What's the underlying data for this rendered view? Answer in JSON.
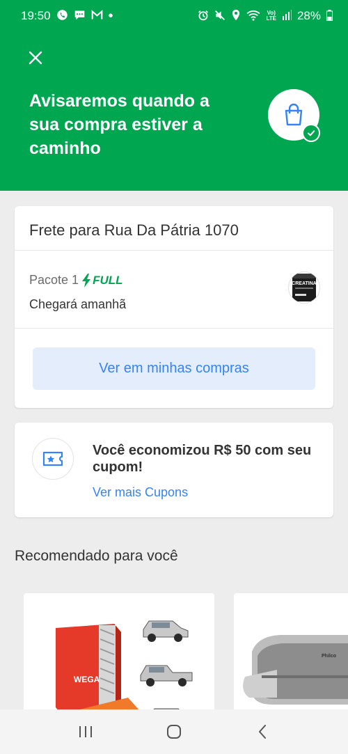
{
  "status_bar": {
    "time": "19:50",
    "battery": "28%",
    "left_icons": [
      "whatsapp-icon",
      "chat-icon",
      "gmail-icon"
    ],
    "right_icons": [
      "alarm-icon",
      "mute-icon",
      "location-icon",
      "wifi-icon",
      "volte-icon",
      "signal-icon",
      "battery-icon"
    ]
  },
  "header": {
    "headline": "Avisaremos quando a sua compra estiver a caminho",
    "background_color": "#00a650"
  },
  "shipping": {
    "title": "Frete para Rua Da Pátria 1070",
    "package_label": "Pacote 1",
    "full_label": "FULL",
    "arrival": "Chegará amanhã",
    "product_thumb_text": "CREATINA",
    "button_label": "Ver em minhas compras"
  },
  "coupon": {
    "text": "Você economizou R$ 50 com seu cupom!",
    "link_label": "Ver mais Cupons"
  },
  "recommendations": {
    "title": "Recomendado para você",
    "product_1_brand": "WEGA",
    "product_2_brand": "Philco"
  },
  "colors": {
    "brand_green": "#00a650",
    "link_blue": "#3483fa",
    "button_bg": "#e3edfb"
  }
}
